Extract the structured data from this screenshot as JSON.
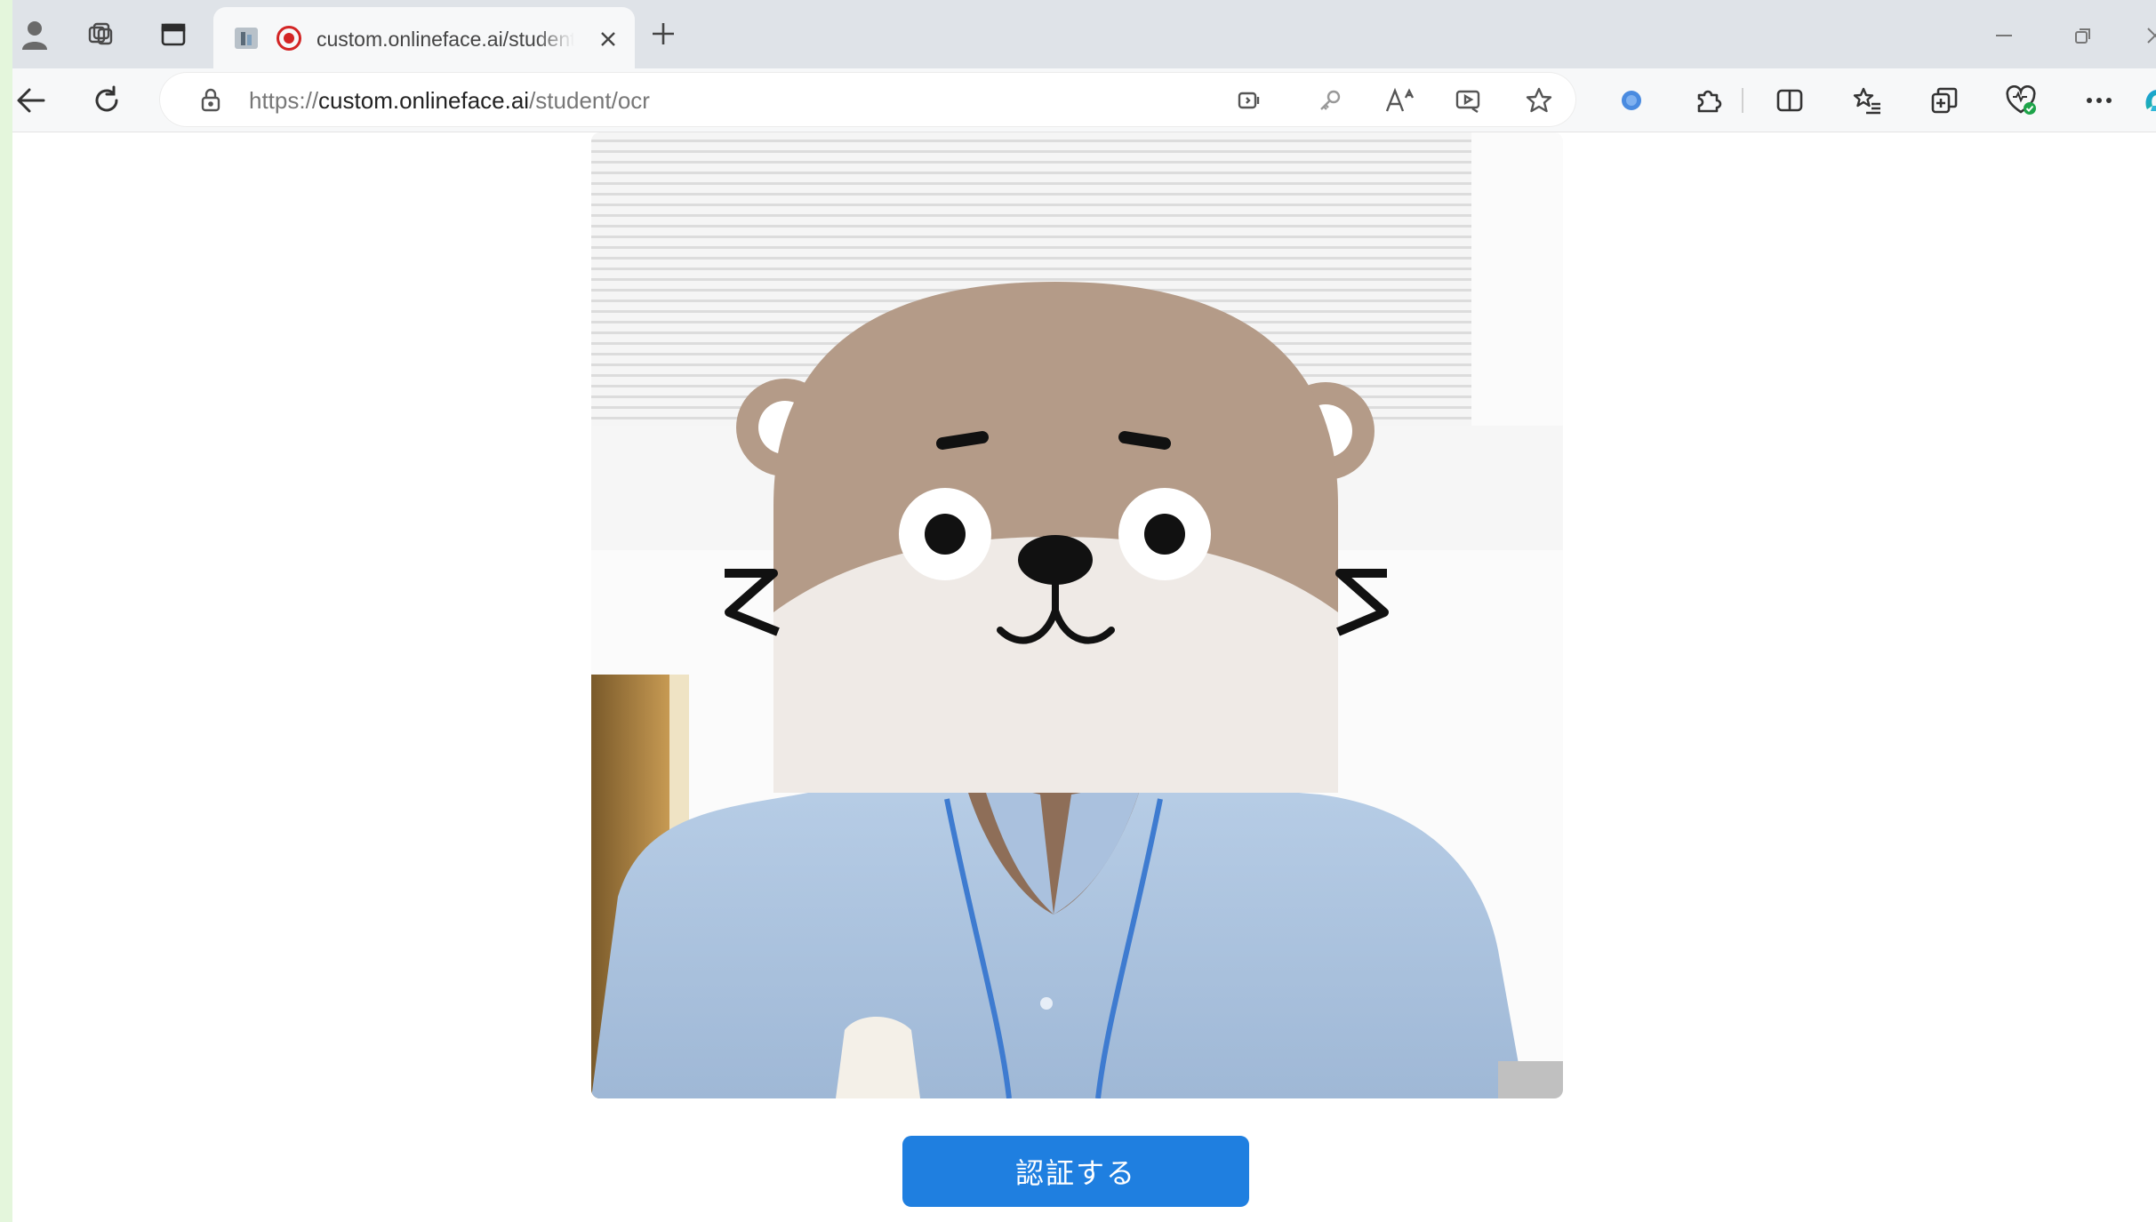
{
  "browser": {
    "tab": {
      "title": "custom.onlineface.ai/student/ocr",
      "recording_icon": "record-icon",
      "favicon": "onlineface-favicon"
    },
    "address": {
      "proto": "https://",
      "host": "custom.onlineface.ai",
      "path": "/student/ocr"
    },
    "icons": {
      "tabstrip": [
        "profile-icon",
        "workspaces-icon",
        "tab-actions-icon"
      ],
      "toolbar_left": [
        "back-arrow-icon",
        "refresh-icon"
      ],
      "address_right": [
        "app-available-icon",
        "key-icon",
        "read-aloud-icon",
        "media-icon",
        "favorite-star-icon"
      ],
      "toolbar_right": [
        "extension-dot-icon",
        "extensions-icon",
        "split-screen-icon",
        "favorites-icon",
        "collections-icon",
        "browser-essentials-icon",
        "more-icon",
        "copilot-icon"
      ],
      "window": [
        "minimize-icon",
        "restore-icon",
        "close-window-icon"
      ]
    }
  },
  "page": {
    "camera": {
      "avatar": "otter-avatar-overlay"
    },
    "verify_button_label": "認証する",
    "accent_color": "#1f7fe0"
  }
}
